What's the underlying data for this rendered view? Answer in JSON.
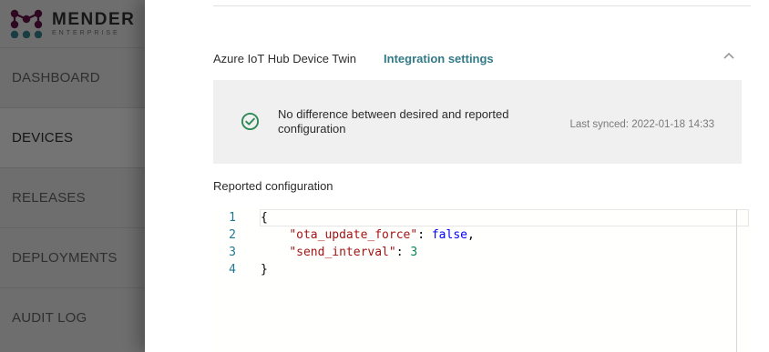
{
  "app": {
    "brand": "MENDER",
    "edition": "ENTERPRISE",
    "brand_colors": {
      "purple": "#5d0f43",
      "teal": "#337a87"
    }
  },
  "sidebar": {
    "items": [
      {
        "label": "DASHBOARD",
        "active": false
      },
      {
        "label": "DEVICES",
        "active": true
      },
      {
        "label": "RELEASES",
        "active": false
      },
      {
        "label": "DEPLOYMENTS",
        "active": false
      },
      {
        "label": "AUDIT LOG",
        "active": false
      }
    ]
  },
  "integration": {
    "title": "Azure IoT Hub Device Twin",
    "settings_link": "Integration settings",
    "collapse_icon": "chevron-up-icon"
  },
  "sync": {
    "status_icon": "check-circle-icon",
    "status_color": "#2e8b57",
    "message": "No difference between desired and reported configuration",
    "last_synced": "Last synced: 2022-01-18 14:33"
  },
  "reported": {
    "label": "Reported configuration",
    "line_numbers": [
      "1",
      "2",
      "3",
      "4"
    ],
    "lines": [
      {
        "indent": "",
        "open": "{"
      },
      {
        "indent": "    ",
        "key": "\"ota_update_force\"",
        "sep": ": ",
        "value": "false",
        "value_type": "bool",
        "trail": ","
      },
      {
        "indent": "    ",
        "key": "\"send_interval\"",
        "sep": ": ",
        "value": "3",
        "value_type": "num",
        "trail": ""
      },
      {
        "indent": "",
        "open": "}"
      }
    ]
  }
}
